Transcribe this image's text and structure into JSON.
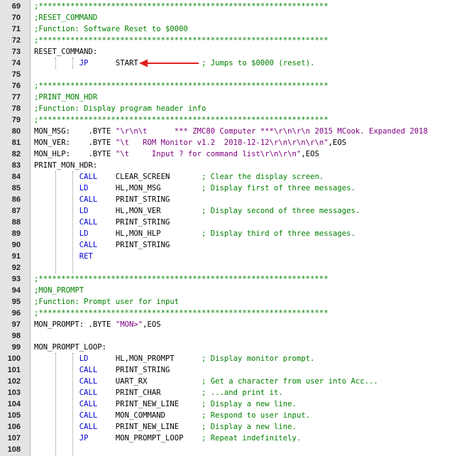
{
  "lines": [
    {
      "num": "69",
      "tokens": [
        {
          "t": ";****************************************************************",
          "c": "comment"
        }
      ]
    },
    {
      "num": "70",
      "tokens": [
        {
          "t": ";RESET_COMMAND",
          "c": "comment"
        }
      ]
    },
    {
      "num": "71",
      "tokens": [
        {
          "t": ";Function: Software Reset to $0000",
          "c": "comment"
        }
      ]
    },
    {
      "num": "72",
      "tokens": [
        {
          "t": ";****************************************************************",
          "c": "comment"
        }
      ]
    },
    {
      "num": "73",
      "tokens": [
        {
          "t": "RESET_COMMAND:",
          "c": "plain"
        }
      ]
    },
    {
      "num": "74",
      "tokens": [
        {
          "t": "          ",
          "c": "plain"
        },
        {
          "t": "JP",
          "c": "keyword"
        },
        {
          "t": "      START              ",
          "c": "plain"
        },
        {
          "t": "; Jumps to $0000 (reset).",
          "c": "comment"
        }
      ]
    },
    {
      "num": "75",
      "tokens": []
    },
    {
      "num": "76",
      "tokens": [
        {
          "t": ";****************************************************************",
          "c": "comment"
        }
      ]
    },
    {
      "num": "77",
      "tokens": [
        {
          "t": ";PRINT_MON_HDR",
          "c": "comment"
        }
      ]
    },
    {
      "num": "78",
      "tokens": [
        {
          "t": ";Function: Display program header info",
          "c": "comment"
        }
      ]
    },
    {
      "num": "79",
      "tokens": [
        {
          "t": ";****************************************************************",
          "c": "comment"
        }
      ]
    },
    {
      "num": "80",
      "tokens": [
        {
          "t": "MON_MSG:    .BYTE ",
          "c": "plain"
        },
        {
          "t": "\"\\r\\n\\t      *** ZMC80 Computer ***\\r\\n\\r\\n 2015 MCook. Expanded 2018",
          "c": "string"
        }
      ]
    },
    {
      "num": "81",
      "tokens": [
        {
          "t": "MON_VER:    .BYTE ",
          "c": "plain"
        },
        {
          "t": "\"\\t   ROM Monitor v1.2  2018-12-12\\r\\n\\r\\n\\r\\n\"",
          "c": "string"
        },
        {
          "t": ",EOS",
          "c": "plain"
        }
      ]
    },
    {
      "num": "82",
      "tokens": [
        {
          "t": "MON_HLP:    .BYTE ",
          "c": "plain"
        },
        {
          "t": "\"\\t     Input ? for command list\\r\\n\\r\\n\"",
          "c": "string"
        },
        {
          "t": ",EOS",
          "c": "plain"
        }
      ]
    },
    {
      "num": "83",
      "tokens": [
        {
          "t": "PRINT_MON_HDR:",
          "c": "plain"
        }
      ]
    },
    {
      "num": "84",
      "tokens": [
        {
          "t": "          ",
          "c": "plain"
        },
        {
          "t": "CALL",
          "c": "keyword"
        },
        {
          "t": "    CLEAR_SCREEN       ",
          "c": "plain"
        },
        {
          "t": "; Clear the display screen.",
          "c": "comment"
        }
      ]
    },
    {
      "num": "85",
      "tokens": [
        {
          "t": "          ",
          "c": "plain"
        },
        {
          "t": "LD",
          "c": "keyword"
        },
        {
          "t": "      HL,MON_MSG         ",
          "c": "plain"
        },
        {
          "t": "; Display first of three messages.",
          "c": "comment"
        }
      ]
    },
    {
      "num": "86",
      "tokens": [
        {
          "t": "          ",
          "c": "plain"
        },
        {
          "t": "CALL",
          "c": "keyword"
        },
        {
          "t": "    PRINT_STRING",
          "c": "plain"
        }
      ]
    },
    {
      "num": "87",
      "tokens": [
        {
          "t": "          ",
          "c": "plain"
        },
        {
          "t": "LD",
          "c": "keyword"
        },
        {
          "t": "      HL,MON_VER         ",
          "c": "plain"
        },
        {
          "t": "; Display second of three messages.",
          "c": "comment"
        }
      ]
    },
    {
      "num": "88",
      "tokens": [
        {
          "t": "          ",
          "c": "plain"
        },
        {
          "t": "CALL",
          "c": "keyword"
        },
        {
          "t": "    PRINT_STRING",
          "c": "plain"
        }
      ]
    },
    {
      "num": "89",
      "tokens": [
        {
          "t": "          ",
          "c": "plain"
        },
        {
          "t": "LD",
          "c": "keyword"
        },
        {
          "t": "      HL,MON_HLP         ",
          "c": "plain"
        },
        {
          "t": "; Display third of three messages.",
          "c": "comment"
        }
      ]
    },
    {
      "num": "90",
      "tokens": [
        {
          "t": "          ",
          "c": "plain"
        },
        {
          "t": "CALL",
          "c": "keyword"
        },
        {
          "t": "    PRINT_STRING",
          "c": "plain"
        }
      ]
    },
    {
      "num": "91",
      "tokens": [
        {
          "t": "          ",
          "c": "plain"
        },
        {
          "t": "RET",
          "c": "keyword"
        }
      ]
    },
    {
      "num": "92",
      "tokens": []
    },
    {
      "num": "93",
      "tokens": [
        {
          "t": ";****************************************************************",
          "c": "comment"
        }
      ]
    },
    {
      "num": "94",
      "tokens": [
        {
          "t": ";MON_PROMPT",
          "c": "comment"
        }
      ]
    },
    {
      "num": "95",
      "tokens": [
        {
          "t": ";Function: Prompt user for input",
          "c": "comment"
        }
      ]
    },
    {
      "num": "96",
      "tokens": [
        {
          "t": ";****************************************************************",
          "c": "comment"
        }
      ]
    },
    {
      "num": "97",
      "tokens": [
        {
          "t": "MON_PROMPT: .BYTE ",
          "c": "plain"
        },
        {
          "t": "\"MON>\"",
          "c": "string"
        },
        {
          "t": ",EOS",
          "c": "plain"
        }
      ]
    },
    {
      "num": "98",
      "tokens": []
    },
    {
      "num": "99",
      "tokens": [
        {
          "t": "MON_PROMPT_LOOP:",
          "c": "plain"
        }
      ]
    },
    {
      "num": "100",
      "tokens": [
        {
          "t": "          ",
          "c": "plain"
        },
        {
          "t": "LD",
          "c": "keyword"
        },
        {
          "t": "      HL,MON_PROMPT      ",
          "c": "plain"
        },
        {
          "t": "; Display monitor prompt.",
          "c": "comment"
        }
      ]
    },
    {
      "num": "101",
      "tokens": [
        {
          "t": "          ",
          "c": "plain"
        },
        {
          "t": "CALL",
          "c": "keyword"
        },
        {
          "t": "    PRINT_STRING",
          "c": "plain"
        }
      ]
    },
    {
      "num": "102",
      "tokens": [
        {
          "t": "          ",
          "c": "plain"
        },
        {
          "t": "CALL",
          "c": "keyword"
        },
        {
          "t": "    UART_RX            ",
          "c": "plain"
        },
        {
          "t": "; Get a character from user into Acc...",
          "c": "comment"
        }
      ]
    },
    {
      "num": "103",
      "tokens": [
        {
          "t": "          ",
          "c": "plain"
        },
        {
          "t": "CALL",
          "c": "keyword"
        },
        {
          "t": "    PRINT_CHAR         ",
          "c": "plain"
        },
        {
          "t": "; ...and print it.",
          "c": "comment"
        }
      ]
    },
    {
      "num": "104",
      "tokens": [
        {
          "t": "          ",
          "c": "plain"
        },
        {
          "t": "CALL",
          "c": "keyword"
        },
        {
          "t": "    PRINT_NEW_LINE     ",
          "c": "plain"
        },
        {
          "t": "; Display a new line.",
          "c": "comment"
        }
      ]
    },
    {
      "num": "105",
      "tokens": [
        {
          "t": "          ",
          "c": "plain"
        },
        {
          "t": "CALL",
          "c": "keyword"
        },
        {
          "t": "    MON_COMMAND        ",
          "c": "plain"
        },
        {
          "t": "; Respond to user input.",
          "c": "comment"
        }
      ]
    },
    {
      "num": "106",
      "tokens": [
        {
          "t": "          ",
          "c": "plain"
        },
        {
          "t": "CALL",
          "c": "keyword"
        },
        {
          "t": "    PRINT_NEW_LINE     ",
          "c": "plain"
        },
        {
          "t": "; Display a new line.",
          "c": "comment"
        }
      ]
    },
    {
      "num": "107",
      "tokens": [
        {
          "t": "          ",
          "c": "plain"
        },
        {
          "t": "JP",
          "c": "keyword"
        },
        {
          "t": "      MON_PROMPT_LOOP    ",
          "c": "plain"
        },
        {
          "t": "; Repeat indefinitely.",
          "c": "comment"
        }
      ]
    },
    {
      "num": "108",
      "tokens": []
    }
  ],
  "colors": {
    "comment": "#008000",
    "keyword": "#0000d0",
    "string": "#800080",
    "plain": "#000000",
    "arrow": "#e02020",
    "gutter": "#e4e4e4"
  },
  "annotation": {
    "icon": "arrow-left-icon",
    "target_line": "74"
  }
}
